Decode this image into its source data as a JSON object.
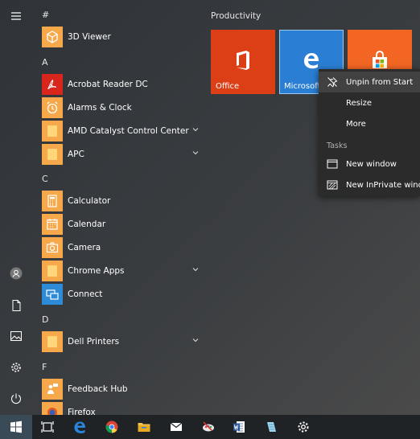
{
  "start_menu": {
    "app_list": {
      "groups": [
        {
          "letter": "#",
          "apps": [
            {
              "label": "3D Viewer",
              "icon": "cube-icon",
              "color": "#f7a84a",
              "expand": false
            }
          ]
        },
        {
          "letter": "A",
          "apps": [
            {
              "label": "Acrobat Reader DC",
              "icon": "acrobat-icon",
              "color": "#d9261c",
              "expand": false
            },
            {
              "label": "Alarms & Clock",
              "icon": "alarm-clock-icon",
              "color": "#f7a84a",
              "expand": false
            },
            {
              "label": "AMD Catalyst Control Center",
              "icon": "folder-icon",
              "color": "#f7a84a",
              "expand": true
            },
            {
              "label": "APC",
              "icon": "folder-icon",
              "color": "#f7a84a",
              "expand": true
            }
          ]
        },
        {
          "letter": "C",
          "apps": [
            {
              "label": "Calculator",
              "icon": "calculator-icon",
              "color": "#f7a84a",
              "expand": false
            },
            {
              "label": "Calendar",
              "icon": "calendar-icon",
              "color": "#f7a84a",
              "expand": false
            },
            {
              "label": "Camera",
              "icon": "camera-icon",
              "color": "#f7a84a",
              "expand": false
            },
            {
              "label": "Chrome Apps",
              "icon": "folder-icon",
              "color": "#f7a84a",
              "expand": true
            },
            {
              "label": "Connect",
              "icon": "connect-icon",
              "color": "#2e8bd8",
              "expand": false
            }
          ]
        },
        {
          "letter": "D",
          "apps": [
            {
              "label": "Dell Printers",
              "icon": "folder-icon",
              "color": "#f7a84a",
              "expand": true
            }
          ]
        },
        {
          "letter": "F",
          "apps": [
            {
              "label": "Feedback Hub",
              "icon": "feedback-icon",
              "color": "#f7a84a",
              "expand": false
            },
            {
              "label": "Firefox",
              "icon": "firefox-icon",
              "color": "#f7a84a",
              "expand": false
            }
          ]
        }
      ]
    },
    "tiles": {
      "group_title": "Productivity",
      "items": [
        {
          "label": "Office",
          "icon": "office-icon",
          "color": "#dc3e15"
        },
        {
          "label": "Microsoft Edge",
          "icon": "edge-icon",
          "color": "#2a7fd4"
        },
        {
          "label": "",
          "icon": "store-icon",
          "color": "#f26522"
        }
      ]
    },
    "context_menu": {
      "items": [
        {
          "label": "Unpin from Start",
          "icon": "unpin-icon"
        },
        {
          "label": "Resize",
          "icon": ""
        },
        {
          "label": "More",
          "icon": ""
        }
      ],
      "tasks_heading": "Tasks",
      "tasks": [
        {
          "label": "New window",
          "icon": "new-window-icon"
        },
        {
          "label": "New InPrivate window",
          "icon": "inprivate-window-icon"
        }
      ]
    }
  },
  "taskbar": {
    "buttons": [
      "windows-start-icon",
      "task-view-icon",
      "edge-icon",
      "chrome-icon",
      "file-explorer-icon",
      "mail-icon",
      "paint-icon",
      "word-icon",
      "notepad-icon",
      "settings-gear-icon"
    ]
  }
}
